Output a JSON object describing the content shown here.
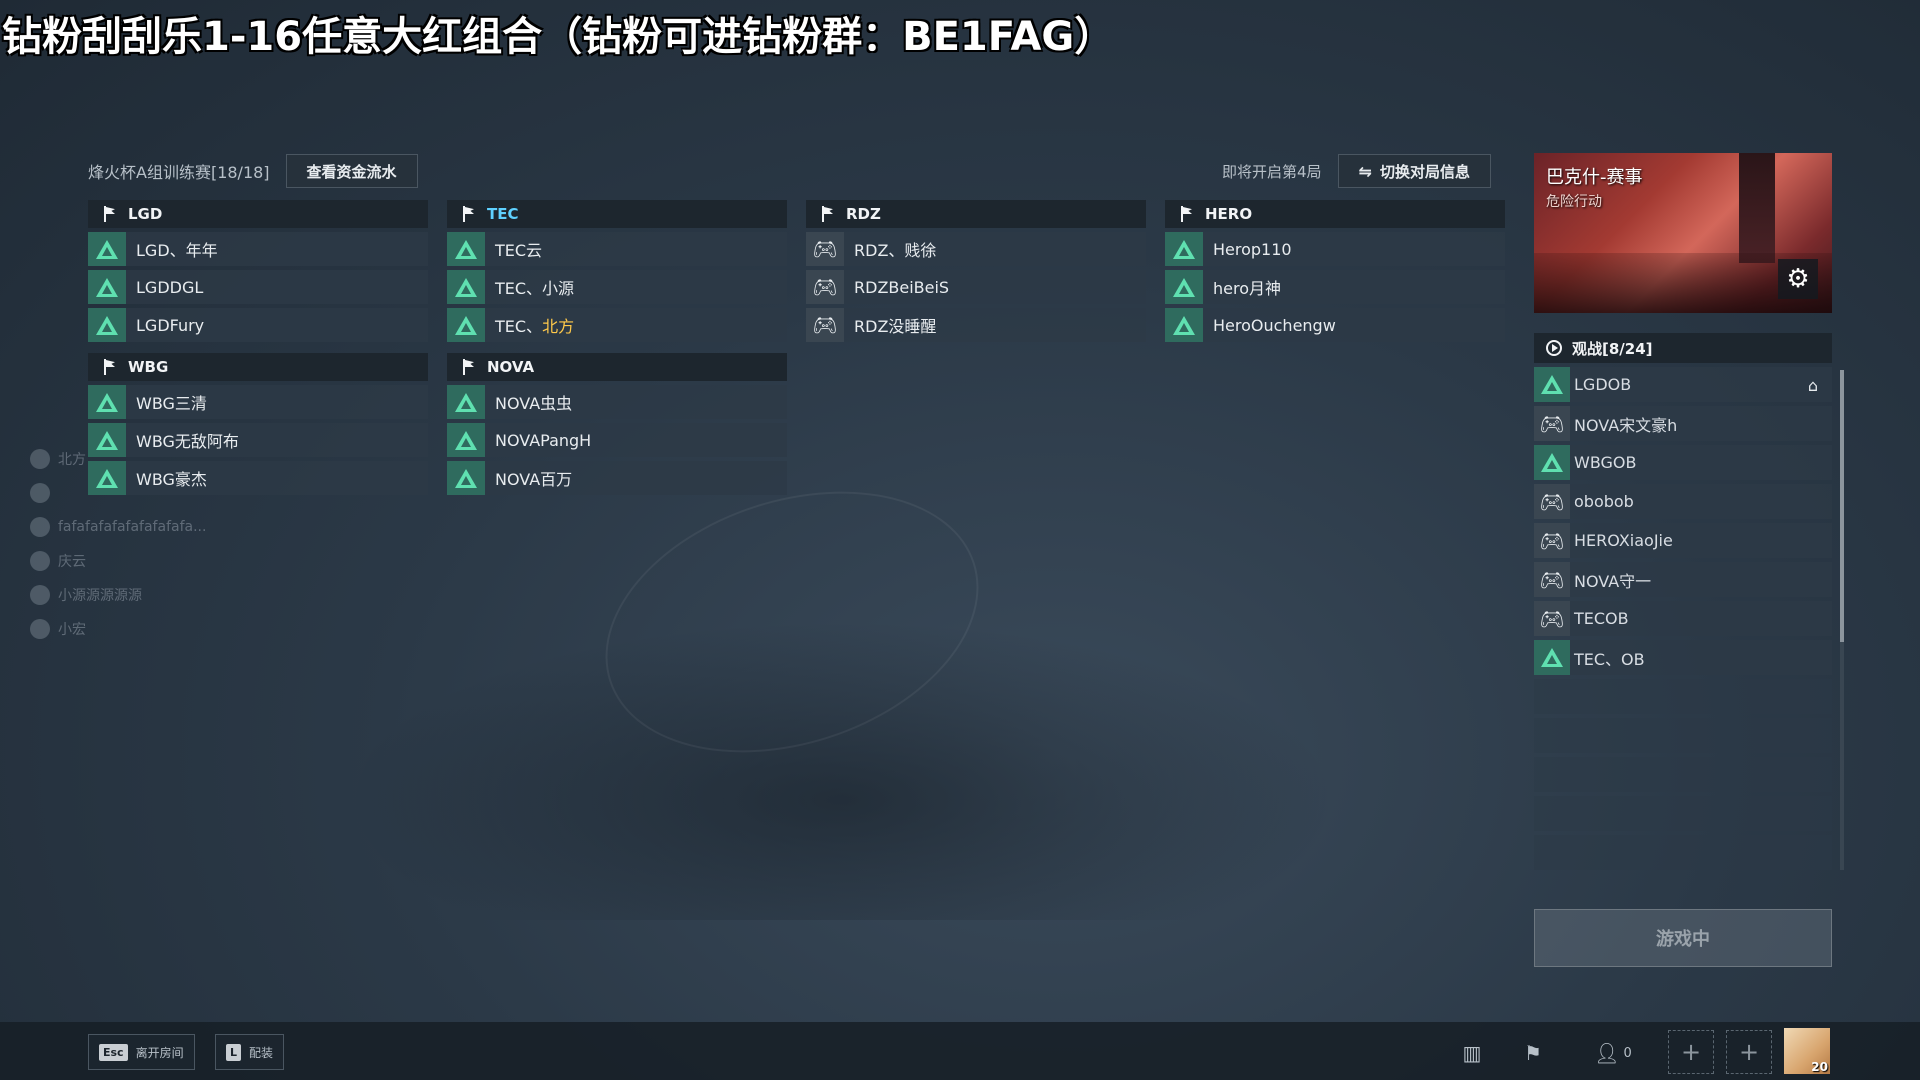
{
  "overlay": {
    "headline": "钻粉刮刮乐1-16任意大红组合（钻粉可进钻粉群：BE1FAG）"
  },
  "room": {
    "title": "烽火杯A组训练赛[18/18]",
    "funds_button": "查看资金流水"
  },
  "round": {
    "note": "即将开启第4局",
    "swap_button": "切换对局信息"
  },
  "teams": [
    {
      "name": "LGD",
      "accent": false,
      "players": [
        {
          "name": "LGD、年年",
          "avatar": "triangle-icon"
        },
        {
          "name": "LGDDGL",
          "avatar": "triangle-icon"
        },
        {
          "name": "LGDFury",
          "avatar": "triangle-icon"
        }
      ]
    },
    {
      "name": "TEC",
      "accent": true,
      "players": [
        {
          "name": "TEC云",
          "avatar": "triangle-icon"
        },
        {
          "name": "TEC、小源",
          "avatar": "triangle-icon"
        },
        {
          "name_prefix": "TEC、",
          "name_highlight": "北方",
          "avatar": "triangle-icon"
        }
      ]
    },
    {
      "name": "RDZ",
      "accent": false,
      "players": [
        {
          "name": "RDZ、贱徐",
          "avatar": "gamepad-icon"
        },
        {
          "name": "RDZBeiBeiS",
          "avatar": "gamepad-icon"
        },
        {
          "name": "RDZ没睡醒",
          "avatar": "gamepad-icon"
        }
      ]
    },
    {
      "name": "HERO",
      "accent": false,
      "players": [
        {
          "name": "Herop110",
          "avatar": "triangle-icon"
        },
        {
          "name": "hero月神",
          "avatar": "triangle-icon"
        },
        {
          "name": "HeroOuchengw",
          "avatar": "triangle-icon"
        }
      ]
    },
    {
      "name": "WBG",
      "accent": false,
      "players": [
        {
          "name": "WBG三清",
          "avatar": "triangle-icon"
        },
        {
          "name": "WBG无敌阿布",
          "avatar": "triangle-icon"
        },
        {
          "name": "WBG豪杰",
          "avatar": "triangle-icon"
        }
      ]
    },
    {
      "name": "NOVA",
      "accent": false,
      "players": [
        {
          "name": "NOVA虫虫",
          "avatar": "triangle-icon"
        },
        {
          "name": "NOVAPangH",
          "avatar": "triangle-icon"
        },
        {
          "name": "NOVA百万",
          "avatar": "triangle-icon"
        }
      ]
    }
  ],
  "map": {
    "title": "巴克什-赛事",
    "mode": "危险行动",
    "settings_icon": "gear-icon"
  },
  "spectators": {
    "header": "观战[8/24]",
    "list": [
      {
        "name": "LGDOB",
        "avatar": "triangle-icon",
        "host": true
      },
      {
        "name": "NOVA宋文豪h",
        "avatar": "gamepad-icon"
      },
      {
        "name": "WBGOB",
        "avatar": "triangle-icon"
      },
      {
        "name": "obobob",
        "avatar": "gamepad-icon"
      },
      {
        "name": "HEROXiaoJie",
        "avatar": "gamepad-icon"
      },
      {
        "name": "NOVA守一",
        "avatar": "gamepad-icon"
      },
      {
        "name": "TECOB",
        "avatar": "gamepad-icon"
      },
      {
        "name": "TEC、OB",
        "avatar": "triangle-icon"
      }
    ],
    "empty_rows": 5
  },
  "status_button": "游戏中",
  "chat": [
    {
      "text": "北方"
    },
    {
      "text": ""
    },
    {
      "text": "fafafafafafafafafafa..."
    },
    {
      "text": "庆云"
    },
    {
      "text": "小源源源源源"
    },
    {
      "text": "小宏"
    }
  ],
  "bottom": {
    "leave_key": "Esc",
    "leave_label": "离开房间",
    "loadout_key": "L",
    "loadout_label": "配装",
    "friends_count": "0",
    "level": "20"
  },
  "colors": {
    "triangle": "#5fe0b0",
    "team_accent": "#5fd1ff",
    "highlight": "#ffc94a"
  }
}
